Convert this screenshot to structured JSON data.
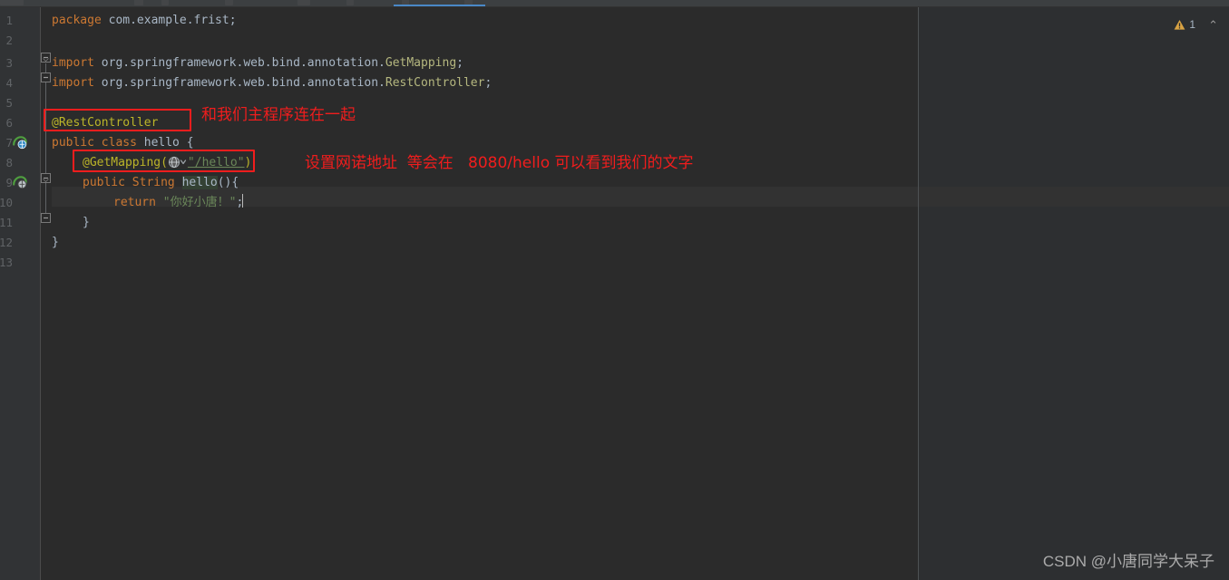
{
  "window": {
    "theme_background": "#2b2b2b",
    "gutter_background": "#313335",
    "accent_tab_color": "#4a88c7"
  },
  "inspection": {
    "warning_icon": "warning-triangle-icon",
    "warning_count": "1",
    "collapse_icon": "chevron-up-icon",
    "collapse_glyph": "⌃"
  },
  "gutter": {
    "line_numbers": [
      "1",
      "2",
      "3",
      "4",
      "5",
      "6",
      "7",
      "8",
      "9",
      "10",
      "11",
      "12",
      "13"
    ],
    "bean_icon_lines": [
      7,
      9
    ],
    "bean_icon_name": "spring-bean-icon"
  },
  "code": {
    "language": "java",
    "lines": [
      {
        "n": 1,
        "tokens": [
          {
            "t": "package",
            "c": "kw"
          },
          {
            "t": " com.example.frist",
            "c": "plain"
          },
          {
            "t": ";",
            "c": "plain"
          }
        ]
      },
      {
        "n": 2,
        "tokens": []
      },
      {
        "n": 3,
        "tokens": [
          {
            "t": "import",
            "c": "kw"
          },
          {
            "t": " org.springframework.web.bind.annotation.",
            "c": "plain"
          },
          {
            "t": "GetMapping",
            "c": "cls"
          },
          {
            "t": ";",
            "c": "plain"
          }
        ]
      },
      {
        "n": 4,
        "tokens": [
          {
            "t": "import",
            "c": "kw"
          },
          {
            "t": " org.springframework.web.bind.annotation.",
            "c": "plain"
          },
          {
            "t": "RestController",
            "c": "cls"
          },
          {
            "t": ";",
            "c": "plain"
          }
        ]
      },
      {
        "n": 5,
        "tokens": []
      },
      {
        "n": 6,
        "tokens": [
          {
            "t": "@RestController",
            "c": "ann"
          }
        ]
      },
      {
        "n": 7,
        "tokens": [
          {
            "t": "public class",
            "c": "kw"
          },
          {
            "t": " hello {",
            "c": "plain"
          }
        ]
      },
      {
        "n": 8,
        "tokens": [
          {
            "t": "@GetMapping(",
            "c": "ann"
          },
          {
            "t": "\"/hello\"",
            "c": "str"
          },
          {
            "t": ")",
            "c": "ann"
          }
        ]
      },
      {
        "n": 9,
        "tokens": [
          {
            "t": "public String",
            "c": "kw"
          },
          {
            "t": " hello(){",
            "c": "plain"
          }
        ]
      },
      {
        "n": 10,
        "tokens": [
          {
            "t": "return",
            "c": "kw"
          },
          {
            "t": " \"你好小唐！\"",
            "c": "str"
          },
          {
            "t": ";",
            "c": "plain"
          }
        ]
      },
      {
        "n": 11,
        "tokens": [
          {
            "t": "}",
            "c": "plain"
          }
        ]
      },
      {
        "n": 12,
        "tokens": [
          {
            "t": "}",
            "c": "plain"
          }
        ]
      },
      {
        "n": 13,
        "tokens": []
      }
    ],
    "line_1": "package com.example.frist;",
    "line_3": "import org.springframework.web.bind.annotation.GetMapping;",
    "line_4": "import org.springframework.web.bind.annotation.RestController;",
    "line_6": "@RestController",
    "line_7_kw": "public class",
    "line_7_rest": " hello {",
    "line_8_ann_open": "@GetMapping(",
    "line_8_path": "\"/hello\"",
    "line_8_ann_close": ")",
    "line_9_kw": "public String",
    "line_9_name": "hello",
    "line_9_tail": "(){",
    "line_10_kw": "return",
    "line_10_str": "\"你好小唐！\"",
    "line_10_semi": ";",
    "line_11": "}",
    "line_12": "}",
    "package_kw": "package",
    "package_name": " com.example.frist",
    "semicolon": ";",
    "import_kw": "import",
    "import_pkg": " org.springframework.web.bind.annotation.",
    "import_cls_1": "GetMapping",
    "import_cls_2": "RestController"
  },
  "annotations": [
    {
      "id": "rest-controller-highlight",
      "kind": "box",
      "target": "@RestController"
    },
    {
      "id": "rest-controller-note",
      "kind": "text",
      "text": "和我们主程序连在一起",
      "color": "#f01d1d"
    },
    {
      "id": "get-mapping-highlight",
      "kind": "box",
      "target": "@GetMapping(\"/hello\")"
    },
    {
      "id": "get-mapping-note",
      "kind": "text",
      "text": "设置网诺地址  等会在   8080/hello 可以看到我们的文字",
      "color": "#f01d1d"
    }
  ],
  "notes": {
    "note_1": "和我们主程序连在一起",
    "note_2": "设置网诺地址  等会在   8080/hello 可以看到我们的文字"
  },
  "watermark": {
    "text": "CSDN @小唐同学大呆子"
  }
}
